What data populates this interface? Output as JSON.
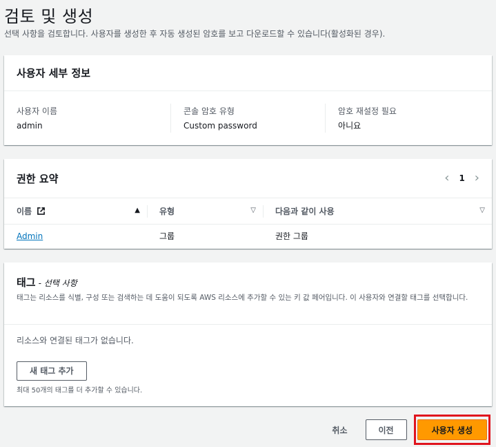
{
  "page": {
    "title": "검토 및 생성",
    "description": "선택 사항을 검토합니다. 사용자를 생성한 후 자동 생성된 암호를 보고 다운로드할 수 있습니다(활성화된 경우)."
  },
  "user_details": {
    "title": "사용자 세부 정보",
    "fields": [
      {
        "label": "사용자 이름",
        "value": "admin"
      },
      {
        "label": "콘솔 암호 유형",
        "value": "Custom password"
      },
      {
        "label": "암호 재설정 필요",
        "value": "아니요"
      }
    ]
  },
  "permissions": {
    "title": "권한 요약",
    "page": "1",
    "columns": [
      "이름",
      "유형",
      "다음과 같이 사용"
    ],
    "rows": [
      {
        "name": "Admin",
        "type": "그룹",
        "used_as": "권한 그룹"
      }
    ]
  },
  "tags": {
    "title": "태그",
    "optional": "- 선택 사항",
    "description": "태그는 리소스를 식별, 구성 또는 검색하는 데 도움이 되도록 AWS 리소스에 추가할 수 있는 키 값 페어입니다. 이 사용자와 연결할 태그를 선택합니다.",
    "empty": "리소스와 연결된 태그가 없습니다.",
    "add_button": "새 태그 추가",
    "hint": "최대 50개의 태그를 더 추가할 수 있습니다."
  },
  "footer": {
    "cancel": "취소",
    "previous": "이전",
    "create": "사용자 생성"
  },
  "colors": {
    "primary": "#ff9900",
    "link": "#0073bb",
    "highlight": "#e0141e"
  }
}
